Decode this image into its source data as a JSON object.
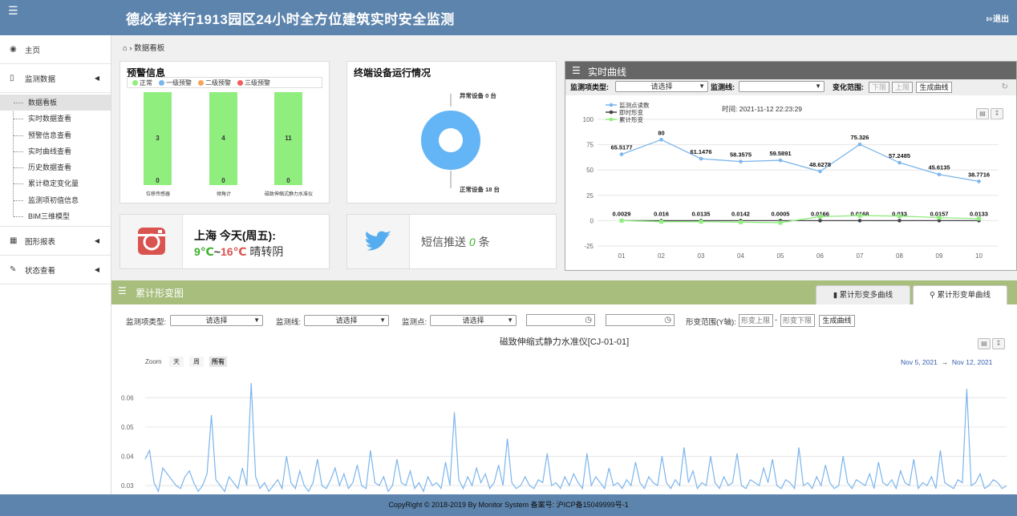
{
  "header": {
    "menu_icon": "hamburger-icon",
    "title": "德必老洋行1913园区24小时全方位建筑实时安全监测",
    "logout_label": "退出",
    "logout_icon": "logout-icon"
  },
  "sidebar": {
    "home": {
      "label": "主页",
      "icon": "dashboard-icon"
    },
    "monitoring": {
      "label": "监测数据",
      "icon": "bookmark-icon",
      "items": [
        {
          "label": "数据看板"
        },
        {
          "label": "实时数据查看"
        },
        {
          "label": "预警信息查看"
        },
        {
          "label": "实时曲线查看"
        },
        {
          "label": "历史数据查看"
        },
        {
          "label": "累计稳定变化量"
        },
        {
          "label": "监测项初值信息"
        },
        {
          "label": "BIM三维模型"
        }
      ]
    },
    "reports": {
      "label": "图形报表",
      "icon": "table-icon"
    },
    "status": {
      "label": "状态查看",
      "icon": "edit-icon"
    }
  },
  "breadcrumb": {
    "icon": "home-icon",
    "label": "数据看板"
  },
  "warning": {
    "title": "预警信息",
    "legend": [
      {
        "label": "正常",
        "color": "#90ee7e"
      },
      {
        "label": "一级预警",
        "color": "#7cb5ec"
      },
      {
        "label": "二级预警",
        "color": "#f7a35c"
      },
      {
        "label": "三级预警",
        "color": "#f45b5b"
      }
    ],
    "bars": [
      {
        "value": "3",
        "bottom": "0",
        "label": "位移传感器"
      },
      {
        "value": "4",
        "bottom": "0",
        "label": "倾角计"
      },
      {
        "value": "11",
        "bottom": "0",
        "label": "磁致伸缩式静力水准仪"
      }
    ]
  },
  "terminal": {
    "title": "终端设备运行情况",
    "abnormal_label": "异常设备 0 台",
    "normal_label": "正常设备 18 台",
    "normal_count": 18,
    "abnormal_count": 0,
    "color": "#64b5f6"
  },
  "weather": {
    "icon": "instagram-icon",
    "city": "上海 今天(周五):",
    "low": "9℃",
    "sep": "~",
    "high": "16℃",
    "desc": "晴转阴"
  },
  "sms": {
    "icon": "twitter-icon",
    "prefix": "短信推送 ",
    "count": "0",
    "suffix": " 条"
  },
  "realtime": {
    "title": "实时曲线",
    "type_label": "监测项类型:",
    "type_value": "请选择",
    "line_label": "监测线:",
    "line_value": "",
    "range_label": "变化范围:",
    "lower": "下限",
    "upper": "上限",
    "gen_button": "生成曲线",
    "time_text": "时间: 2021-11-12 22:23:29",
    "chart_data": {
      "type": "line",
      "x": [
        1,
        2,
        3,
        4,
        5,
        6,
        7,
        8,
        9,
        10
      ],
      "xticks": [
        "01",
        "02",
        "03",
        "04",
        "05",
        "06",
        "07",
        "08",
        "09",
        "10"
      ],
      "ylim": [
        -25,
        100
      ],
      "yticks": [
        -25,
        0,
        25,
        50,
        75,
        100
      ],
      "series": [
        {
          "name": "监测点读数",
          "color": "#7cb5ec",
          "values": [
            65.5177,
            80,
            61.1476,
            58.3575,
            59.5891,
            48.6278,
            75.326,
            57.2485,
            45.6135,
            38.7716
          ],
          "labels": [
            "65.5177",
            "80",
            "61.1476",
            "58.3575",
            "59.5891",
            "48.6278",
            "75.326",
            "57.2485",
            "45.6135",
            "38.7716"
          ]
        },
        {
          "name": "即时形变",
          "color": "#434348",
          "values": [
            0.0029,
            0.016,
            0.0135,
            0.0142,
            0.0005,
            0.0166,
            0.0168,
            0.033,
            0.0157,
            0.0133
          ],
          "labels": [
            "0.0029",
            "0.016",
            "0.0135",
            "0.0142",
            "0.0005",
            "0.0166",
            "0.0168",
            "0.033",
            "0.0157",
            "0.0133"
          ]
        },
        {
          "name": "累计形变",
          "color": "#90ee7e",
          "values": [
            0,
            -1,
            -1,
            -1.5,
            -2,
            4,
            5,
            4.5,
            3,
            2
          ]
        }
      ]
    }
  },
  "cumulative": {
    "title": "累计形变图",
    "tabs": [
      {
        "label": "累计形变多曲线",
        "icon": "bar-chart-icon"
      },
      {
        "label": "累计形变单曲线",
        "icon": "search-icon"
      }
    ],
    "type_label": "监测项类型:",
    "type_value": "请选择",
    "line_label": "监测线:",
    "line_value": "请选择",
    "point_label": "监测点:",
    "point_value": "请选择",
    "range_label": "形变范围(Y轴):",
    "upper_ph": "形变上限",
    "dash": "-",
    "lower_ph": "形变下限",
    "gen_button": "生成曲线",
    "chart_title": "磁致伸缩式静力水准仪[CJ-01-01]",
    "zoom_label": "Zoom",
    "zoom_options": [
      "天",
      "周",
      "所有"
    ],
    "date_from": "Nov 5, 2021",
    "arrow": "→",
    "date_to": "Nov 12, 2021",
    "chart_data": {
      "type": "line",
      "yticks": [
        0.03,
        0.04,
        0.05,
        0.06
      ],
      "ylim": [
        0.027,
        0.068
      ],
      "color": "#7cb5ec",
      "values": [
        0.039,
        0.042,
        0.031,
        0.028,
        0.036,
        0.034,
        0.032,
        0.03,
        0.029,
        0.033,
        0.035,
        0.031,
        0.028,
        0.03,
        0.034,
        0.054,
        0.032,
        0.03,
        0.028,
        0.033,
        0.031,
        0.029,
        0.036,
        0.03,
        0.065,
        0.033,
        0.029,
        0.031,
        0.028,
        0.03,
        0.032,
        0.029,
        0.04,
        0.031,
        0.029,
        0.035,
        0.03,
        0.028,
        0.031,
        0.039,
        0.03,
        0.029,
        0.032,
        0.036,
        0.03,
        0.034,
        0.029,
        0.031,
        0.037,
        0.03,
        0.029,
        0.042,
        0.031,
        0.03,
        0.033,
        0.028,
        0.03,
        0.039,
        0.031,
        0.03,
        0.035,
        0.029,
        0.031,
        0.028,
        0.033,
        0.03,
        0.031,
        0.029,
        0.038,
        0.03,
        0.055,
        0.032,
        0.029,
        0.033,
        0.03,
        0.036,
        0.031,
        0.034,
        0.029,
        0.031,
        0.037,
        0.03,
        0.046,
        0.031,
        0.029,
        0.03,
        0.033,
        0.03,
        0.029,
        0.032,
        0.031,
        0.041,
        0.03,
        0.031,
        0.029,
        0.033,
        0.03,
        0.034,
        0.031,
        0.029,
        0.041,
        0.03,
        0.033,
        0.031,
        0.029,
        0.036,
        0.03,
        0.031,
        0.029,
        0.032,
        0.03,
        0.038,
        0.031,
        0.029,
        0.033,
        0.031,
        0.03,
        0.04,
        0.031,
        0.029,
        0.032,
        0.03,
        0.043,
        0.031,
        0.035,
        0.029,
        0.031,
        0.03,
        0.04,
        0.031,
        0.029,
        0.033,
        0.03,
        0.031,
        0.041,
        0.03,
        0.029,
        0.032,
        0.031,
        0.03,
        0.036,
        0.031,
        0.039,
        0.03,
        0.029,
        0.032,
        0.031,
        0.029,
        0.043,
        0.03,
        0.031,
        0.029,
        0.033,
        0.03,
        0.037,
        0.031,
        0.029,
        0.03,
        0.04,
        0.031,
        0.029,
        0.032,
        0.031,
        0.03,
        0.034,
        0.029,
        0.038,
        0.031,
        0.03,
        0.032,
        0.029,
        0.035,
        0.031,
        0.03,
        0.039,
        0.029,
        0.031,
        0.03,
        0.033,
        0.029,
        0.042,
        0.031,
        0.03,
        0.029,
        0.032,
        0.031,
        0.063,
        0.03,
        0.031,
        0.034,
        0.029,
        0.03,
        0.032,
        0.031,
        0.029,
        0.03
      ]
    }
  },
  "footer": {
    "text": "CopyRight © 2018-2019 By Monitor System 备案号: 沪ICP备15049999号-1"
  }
}
